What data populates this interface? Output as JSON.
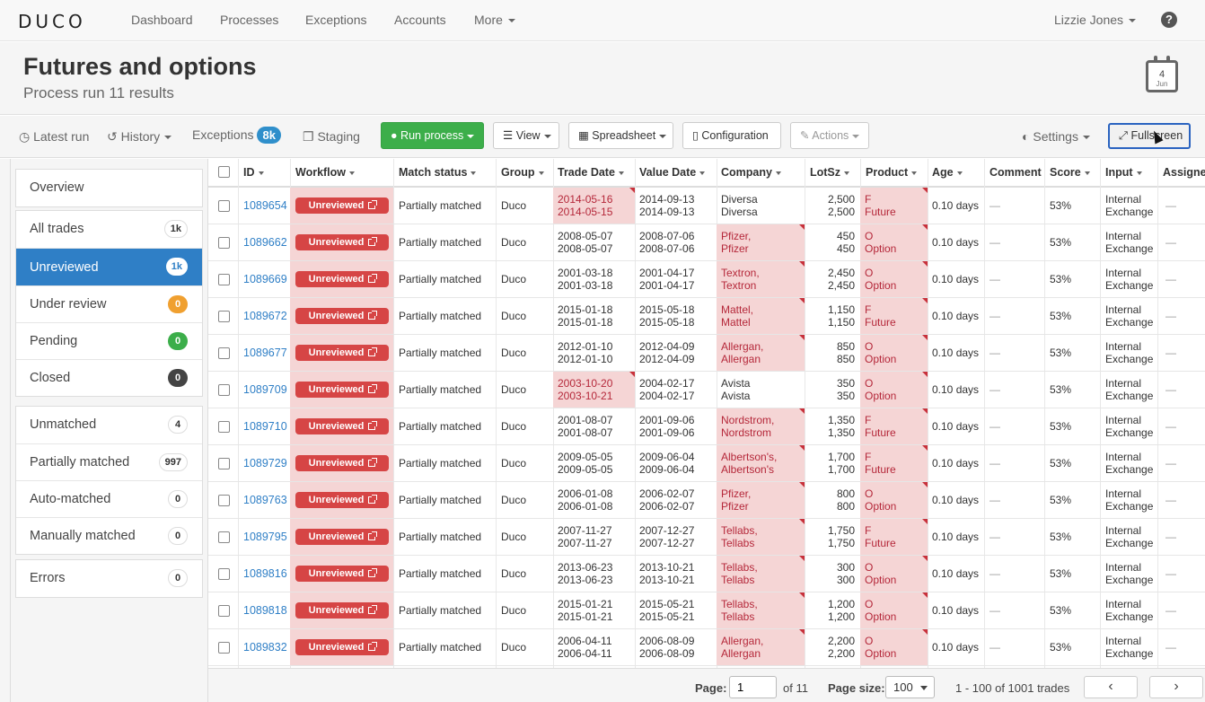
{
  "nav": {
    "logo": "DUCO",
    "items": [
      "Dashboard",
      "Processes",
      "Exceptions",
      "Accounts"
    ],
    "more": "More",
    "user": "Lizzie Jones",
    "help": "?"
  },
  "header": {
    "title": "Futures and options",
    "subtitle": "Process run 11 results",
    "calendar_day": "4",
    "calendar_month": "Jun"
  },
  "toolbar": {
    "latest_run": "Latest run",
    "history": "History",
    "exceptions": "Exceptions",
    "exceptions_count": "8k",
    "staging": "Staging",
    "run_process": "Run process",
    "view": "View",
    "spreadsheet": "Spreadsheet",
    "configuration": "Configuration",
    "actions": "Actions",
    "settings": "Settings",
    "fullscreen": "Fullscreen"
  },
  "sidebar": {
    "group1": [
      {
        "label": "Overview"
      }
    ],
    "group2": [
      {
        "label": "All trades",
        "count": "1k"
      },
      {
        "label": "Unreviewed",
        "count": "1k"
      },
      {
        "label": "Under review",
        "count": "0"
      },
      {
        "label": "Pending",
        "count": "0"
      },
      {
        "label": "Closed",
        "count": "0"
      }
    ],
    "group3": [
      {
        "label": "Unmatched",
        "count": "4"
      },
      {
        "label": "Partially matched",
        "count": "997"
      },
      {
        "label": "Auto-matched",
        "count": "0"
      },
      {
        "label": "Manually matched",
        "count": "0"
      }
    ],
    "group4": [
      {
        "label": "Errors",
        "count": "0"
      }
    ]
  },
  "table": {
    "headers": [
      "ID",
      "Workflow",
      "Match status",
      "Group",
      "Trade Date",
      "Value Date",
      "Company",
      "LotSz",
      "Product",
      "Age",
      "Comment",
      "Score",
      "Input",
      "Assignee"
    ],
    "rows": [
      {
        "id": "1089654",
        "workflow": "Unreviewed",
        "status": "Partially matched",
        "group": "Duco",
        "td1": "2014-05-16",
        "td2": "2014-05-15",
        "vd1": "2014-09-13",
        "vd2": "2014-09-13",
        "co1": "Diversa",
        "co2": "Diversa",
        "lot1": "2,500",
        "lot2": "2,500",
        "p1": "F",
        "p2": "Future",
        "age": "0.10 days",
        "comment": "—",
        "score": "53%",
        "in1": "Internal",
        "in2": "Exchange",
        "assignee": "—"
      },
      {
        "id": "1089662",
        "workflow": "Unreviewed",
        "status": "Partially matched",
        "group": "Duco",
        "td1": "2008-05-07",
        "td2": "2008-05-07",
        "vd1": "2008-07-06",
        "vd2": "2008-07-06",
        "co1": "Pfizer,",
        "co2": "Pfizer",
        "lot1": "450",
        "lot2": "450",
        "p1": "O",
        "p2": "Option",
        "age": "0.10 days",
        "comment": "—",
        "score": "53%",
        "in1": "Internal",
        "in2": "Exchange",
        "assignee": "—"
      },
      {
        "id": "1089669",
        "workflow": "Unreviewed",
        "status": "Partially matched",
        "group": "Duco",
        "td1": "2001-03-18",
        "td2": "2001-03-18",
        "vd1": "2001-04-17",
        "vd2": "2001-04-17",
        "co1": "Textron,",
        "co2": "Textron",
        "lot1": "2,450",
        "lot2": "2,450",
        "p1": "O",
        "p2": "Option",
        "age": "0.10 days",
        "comment": "—",
        "score": "53%",
        "in1": "Internal",
        "in2": "Exchange",
        "assignee": "—"
      },
      {
        "id": "1089672",
        "workflow": "Unreviewed",
        "status": "Partially matched",
        "group": "Duco",
        "td1": "2015-01-18",
        "td2": "2015-01-18",
        "vd1": "2015-05-18",
        "vd2": "2015-05-18",
        "co1": "Mattel,",
        "co2": "Mattel",
        "lot1": "1,150",
        "lot2": "1,150",
        "p1": "F",
        "p2": "Future",
        "age": "0.10 days",
        "comment": "—",
        "score": "53%",
        "in1": "Internal",
        "in2": "Exchange",
        "assignee": "—"
      },
      {
        "id": "1089677",
        "workflow": "Unreviewed",
        "status": "Partially matched",
        "group": "Duco",
        "td1": "2012-01-10",
        "td2": "2012-01-10",
        "vd1": "2012-04-09",
        "vd2": "2012-04-09",
        "co1": "Allergan,",
        "co2": "Allergan",
        "lot1": "850",
        "lot2": "850",
        "p1": "O",
        "p2": "Option",
        "age": "0.10 days",
        "comment": "—",
        "score": "53%",
        "in1": "Internal",
        "in2": "Exchange",
        "assignee": "—"
      },
      {
        "id": "1089709",
        "workflow": "Unreviewed",
        "status": "Partially matched",
        "group": "Duco",
        "td1": "2003-10-20",
        "td2": "2003-10-21",
        "vd1": "2004-02-17",
        "vd2": "2004-02-17",
        "co1": "Avista",
        "co2": "Avista",
        "lot1": "350",
        "lot2": "350",
        "p1": "O",
        "p2": "Option",
        "age": "0.10 days",
        "comment": "—",
        "score": "53%",
        "in1": "Internal",
        "in2": "Exchange",
        "assignee": "—"
      },
      {
        "id": "1089710",
        "workflow": "Unreviewed",
        "status": "Partially matched",
        "group": "Duco",
        "td1": "2001-08-07",
        "td2": "2001-08-07",
        "vd1": "2001-09-06",
        "vd2": "2001-09-06",
        "co1": "Nordstrom,",
        "co2": "Nordstrom",
        "lot1": "1,350",
        "lot2": "1,350",
        "p1": "F",
        "p2": "Future",
        "age": "0.10 days",
        "comment": "—",
        "score": "53%",
        "in1": "Internal",
        "in2": "Exchange",
        "assignee": "—"
      },
      {
        "id": "1089729",
        "workflow": "Unreviewed",
        "status": "Partially matched",
        "group": "Duco",
        "td1": "2009-05-05",
        "td2": "2009-05-05",
        "vd1": "2009-06-04",
        "vd2": "2009-06-04",
        "co1": "Albertson's,",
        "co2": "Albertson's",
        "lot1": "1,700",
        "lot2": "1,700",
        "p1": "F",
        "p2": "Future",
        "age": "0.10 days",
        "comment": "—",
        "score": "53%",
        "in1": "Internal",
        "in2": "Exchange",
        "assignee": "—"
      },
      {
        "id": "1089763",
        "workflow": "Unreviewed",
        "status": "Partially matched",
        "group": "Duco",
        "td1": "2006-01-08",
        "td2": "2006-01-08",
        "vd1": "2006-02-07",
        "vd2": "2006-02-07",
        "co1": "Pfizer,",
        "co2": "Pfizer",
        "lot1": "800",
        "lot2": "800",
        "p1": "O",
        "p2": "Option",
        "age": "0.10 days",
        "comment": "—",
        "score": "53%",
        "in1": "Internal",
        "in2": "Exchange",
        "assignee": "—"
      },
      {
        "id": "1089795",
        "workflow": "Unreviewed",
        "status": "Partially matched",
        "group": "Duco",
        "td1": "2007-11-27",
        "td2": "2007-11-27",
        "vd1": "2007-12-27",
        "vd2": "2007-12-27",
        "co1": "Tellabs,",
        "co2": "Tellabs",
        "lot1": "1,750",
        "lot2": "1,750",
        "p1": "F",
        "p2": "Future",
        "age": "0.10 days",
        "comment": "—",
        "score": "53%",
        "in1": "Internal",
        "in2": "Exchange",
        "assignee": "—"
      },
      {
        "id": "1089816",
        "workflow": "Unreviewed",
        "status": "Partially matched",
        "group": "Duco",
        "td1": "2013-06-23",
        "td2": "2013-06-23",
        "vd1": "2013-10-21",
        "vd2": "2013-10-21",
        "co1": "Tellabs,",
        "co2": "Tellabs",
        "lot1": "300",
        "lot2": "300",
        "p1": "O",
        "p2": "Option",
        "age": "0.10 days",
        "comment": "—",
        "score": "53%",
        "in1": "Internal",
        "in2": "Exchange",
        "assignee": "—"
      },
      {
        "id": "1089818",
        "workflow": "Unreviewed",
        "status": "Partially matched",
        "group": "Duco",
        "td1": "2015-01-21",
        "td2": "2015-01-21",
        "vd1": "2015-05-21",
        "vd2": "2015-05-21",
        "co1": "Tellabs,",
        "co2": "Tellabs",
        "lot1": "1,200",
        "lot2": "1,200",
        "p1": "O",
        "p2": "Option",
        "age": "0.10 days",
        "comment": "—",
        "score": "53%",
        "in1": "Internal",
        "in2": "Exchange",
        "assignee": "—"
      },
      {
        "id": "1089832",
        "workflow": "Unreviewed",
        "status": "Partially matched",
        "group": "Duco",
        "td1": "2006-04-11",
        "td2": "2006-04-11",
        "vd1": "2006-08-09",
        "vd2": "2006-08-09",
        "co1": "Allergan,",
        "co2": "Allergan",
        "lot1": "2,200",
        "lot2": "2,200",
        "p1": "O",
        "p2": "Option",
        "age": "0.10 days",
        "comment": "—",
        "score": "53%",
        "in1": "Internal",
        "in2": "Exchange",
        "assignee": "—"
      }
    ]
  },
  "footer": {
    "page_label": "Page:",
    "page_value": "1",
    "of_pages": "of 11",
    "size_label": "Page size:",
    "size_value": "100",
    "range": "1 - 100 of 1001 trades",
    "prev": "‹",
    "next": "›"
  }
}
